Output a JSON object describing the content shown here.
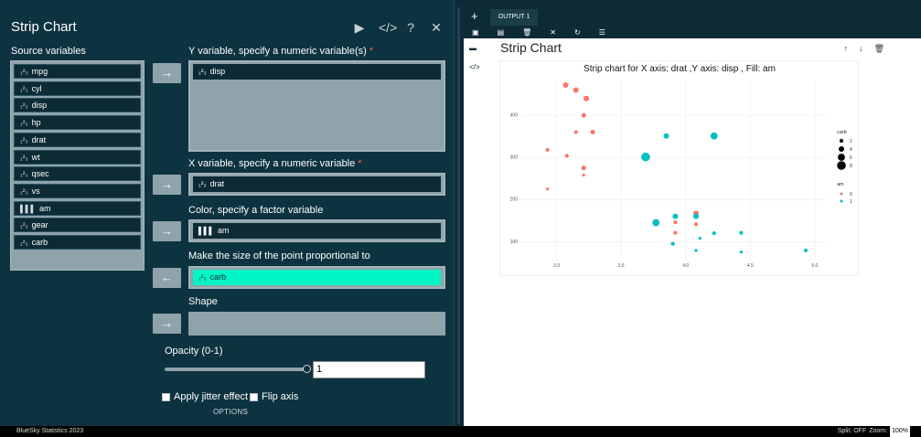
{
  "dialog": {
    "title": "Strip Chart",
    "icons": [
      "play-icon",
      "code-icon",
      "help-icon",
      "close-icon"
    ],
    "icon_glyphs": [
      "▶",
      "</>",
      "?",
      "✕"
    ]
  },
  "source": {
    "label": "Source variables",
    "variables": [
      {
        "name": "mpg",
        "type": "numeric"
      },
      {
        "name": "cyl",
        "type": "numeric"
      },
      {
        "name": "disp",
        "type": "numeric"
      },
      {
        "name": "hp",
        "type": "numeric"
      },
      {
        "name": "drat",
        "type": "numeric"
      },
      {
        "name": "wt",
        "type": "numeric"
      },
      {
        "name": "qsec",
        "type": "numeric"
      },
      {
        "name": "vs",
        "type": "numeric"
      },
      {
        "name": "am",
        "type": "factor"
      },
      {
        "name": "gear",
        "type": "numeric"
      },
      {
        "name": "carb",
        "type": "numeric"
      }
    ]
  },
  "type_icons": {
    "numeric": "₁²₃",
    "factor": "▌▌▌"
  },
  "targets": {
    "y": {
      "label": "Y variable, specify a numeric variable(s)",
      "required": "*",
      "value": "disp",
      "arrow": "→"
    },
    "x": {
      "label": "X variable, specify a numeric variable",
      "required": "*",
      "value": "drat",
      "arrow": "→"
    },
    "color": {
      "label": "Color, specify a factor variable",
      "value": "am",
      "arrow": "→"
    },
    "size": {
      "label": "Make the size of the point proportional to",
      "value": "carb",
      "arrow": "←"
    },
    "shape": {
      "label": "Shape",
      "value": "",
      "arrow": "→"
    }
  },
  "opacity": {
    "label": "Opacity (0-1)",
    "value": "1",
    "slider_fraction": 1.0
  },
  "checkboxes": {
    "jitter": "Apply jitter effect",
    "flip": "Flip axis"
  },
  "options_label": "OPTIONS",
  "output": {
    "plus": "+",
    "tab_label": "OUTPUT 1",
    "toolbar_icons": [
      "open-icon",
      "save-icon",
      "delete-icon",
      "close-icon",
      "refresh-icon",
      "list-icon"
    ],
    "toolbar_glyphs": [
      "▣",
      "▤",
      "🗑",
      "✕",
      "↻",
      "☰"
    ],
    "side_icons": [
      "collapse-icon",
      "code-icon"
    ],
    "side_glyphs": [
      "▬",
      "</>"
    ],
    "title": "Strip Chart",
    "action_glyphs": [
      "↑",
      "↓",
      "🗑"
    ]
  },
  "chart_data": {
    "type": "scatter",
    "title": "Strip chart for X axis: drat ,Y axis: disp , Fill: am",
    "xlabel": "",
    "ylabel": "",
    "xlim": [
      2.72,
      5.1
    ],
    "ylim": [
      55,
      485
    ],
    "xticks": [
      "3.0",
      "3.5",
      "4.0",
      "4.5",
      "5.0"
    ],
    "xtick_values": [
      3.0,
      3.5,
      4.0,
      4.5,
      5.0
    ],
    "yticks": [
      "100",
      "200",
      "300",
      "400"
    ],
    "ytick_values": [
      100,
      200,
      300,
      400
    ],
    "grid": true,
    "colors": {
      "0": "#f8766d",
      "1": "#00bfc4"
    },
    "size_legend": {
      "title": "carb",
      "values": [
        2,
        4,
        6,
        8
      ]
    },
    "color_legend": {
      "title": "am",
      "values": [
        "0",
        "1"
      ]
    },
    "legend_placement": "right",
    "points": [
      {
        "x": 2.93,
        "y": 318,
        "am": "0",
        "carb": 2
      },
      {
        "x": 2.93,
        "y": 225,
        "am": "0",
        "carb": 1
      },
      {
        "x": 3.07,
        "y": 472,
        "am": "0",
        "carb": 4
      },
      {
        "x": 3.15,
        "y": 460,
        "am": "0",
        "carb": 4
      },
      {
        "x": 3.21,
        "y": 400,
        "am": "0",
        "carb": 3
      },
      {
        "x": 3.21,
        "y": 275,
        "am": "0",
        "carb": 3
      },
      {
        "x": 3.21,
        "y": 258,
        "am": "0",
        "carb": 1
      },
      {
        "x": 3.28,
        "y": 360,
        "am": "0",
        "carb": 3
      },
      {
        "x": 3.23,
        "y": 440,
        "am": "0",
        "carb": 4
      },
      {
        "x": 3.08,
        "y": 304,
        "am": "0",
        "carb": 2
      },
      {
        "x": 3.15,
        "y": 360,
        "am": "0",
        "carb": 2
      },
      {
        "x": 3.69,
        "y": 301,
        "am": "1",
        "carb": 8
      },
      {
        "x": 3.85,
        "y": 351,
        "am": "1",
        "carb": 4
      },
      {
        "x": 3.92,
        "y": 146,
        "am": "0",
        "carb": 2
      },
      {
        "x": 3.92,
        "y": 121,
        "am": "0",
        "carb": 2
      },
      {
        "x": 3.77,
        "y": 145,
        "am": "1",
        "carb": 6
      },
      {
        "x": 3.92,
        "y": 160,
        "am": "1",
        "carb": 4
      },
      {
        "x": 3.9,
        "y": 95,
        "am": "1",
        "carb": 2
      },
      {
        "x": 4.08,
        "y": 167,
        "am": "0",
        "carb": 4
      },
      {
        "x": 4.08,
        "y": 160,
        "am": "1",
        "carb": 4
      },
      {
        "x": 4.08,
        "y": 141,
        "am": "0",
        "carb": 2
      },
      {
        "x": 4.11,
        "y": 108,
        "am": "1",
        "carb": 1
      },
      {
        "x": 4.22,
        "y": 120,
        "am": "1",
        "carb": 2
      },
      {
        "x": 4.22,
        "y": 351,
        "am": "1",
        "carb": 6
      },
      {
        "x": 4.08,
        "y": 79,
        "am": "1",
        "carb": 1
      },
      {
        "x": 4.43,
        "y": 75,
        "am": "1",
        "carb": 1
      },
      {
        "x": 4.43,
        "y": 121,
        "am": "1",
        "carb": 2
      },
      {
        "x": 4.93,
        "y": 79,
        "am": "1",
        "carb": 2
      }
    ]
  },
  "status": {
    "left": "BlueSky Statistics 2023",
    "split": "Split: OFF",
    "zoom_label": "Zoom:",
    "zoom_value": "100%"
  }
}
